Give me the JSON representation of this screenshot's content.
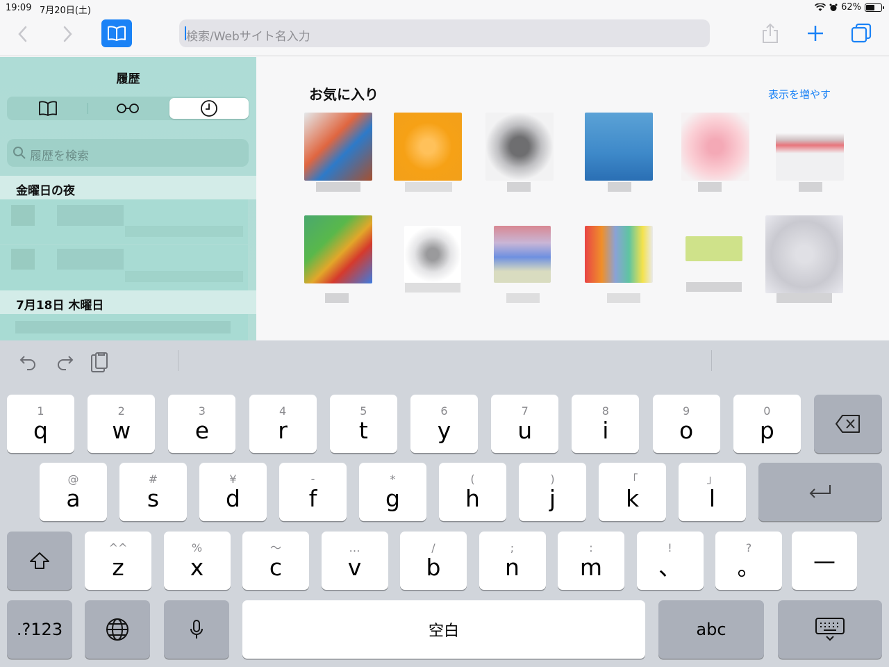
{
  "status": {
    "time": "19:09",
    "date": "7月20日(土)",
    "battery": "62%",
    "battery_level": 0.62
  },
  "toolbar": {
    "url_placeholder": "検索/Webサイト名入力"
  },
  "sidebar": {
    "title": "履歴",
    "search_placeholder": "履歴を検索",
    "sections": [
      {
        "header": "金曜日の夜"
      },
      {
        "header": "7月18日 木曜日"
      }
    ]
  },
  "favorites": {
    "title": "お気に入り",
    "more_label": "表示を増やす"
  },
  "keyboard": {
    "row1": [
      {
        "sub": "1",
        "main": "q"
      },
      {
        "sub": "2",
        "main": "w"
      },
      {
        "sub": "3",
        "main": "e"
      },
      {
        "sub": "4",
        "main": "r"
      },
      {
        "sub": "5",
        "main": "t"
      },
      {
        "sub": "6",
        "main": "y"
      },
      {
        "sub": "7",
        "main": "u"
      },
      {
        "sub": "8",
        "main": "i"
      },
      {
        "sub": "9",
        "main": "o"
      },
      {
        "sub": "0",
        "main": "p"
      }
    ],
    "row2": [
      {
        "sub": "@",
        "main": "a"
      },
      {
        "sub": "#",
        "main": "s"
      },
      {
        "sub": "¥",
        "main": "d"
      },
      {
        "sub": "-",
        "main": "f"
      },
      {
        "sub": "*",
        "main": "g"
      },
      {
        "sub": "(",
        "main": "h"
      },
      {
        "sub": ")",
        "main": "j"
      },
      {
        "sub": "「",
        "main": "k"
      },
      {
        "sub": "」",
        "main": "l"
      }
    ],
    "row3": [
      {
        "sub": "^^",
        "main": "z"
      },
      {
        "sub": "%",
        "main": "x"
      },
      {
        "sub": "〜",
        "main": "c"
      },
      {
        "sub": "…",
        "main": "v"
      },
      {
        "sub": "/",
        "main": "b"
      },
      {
        "sub": ";",
        "main": "n"
      },
      {
        "sub": ":",
        "main": "m"
      },
      {
        "sub": "!",
        "main": "、"
      },
      {
        "sub": "?",
        "main": "。"
      }
    ],
    "dash_key": "—",
    "numbers_key": ".?123",
    "space_key": "空白",
    "abc_key": "abc"
  },
  "colors": {
    "accent": "#1a82f6",
    "sidebar_bg": "#aedcd6",
    "keyboard_bg": "#d1d5db"
  }
}
